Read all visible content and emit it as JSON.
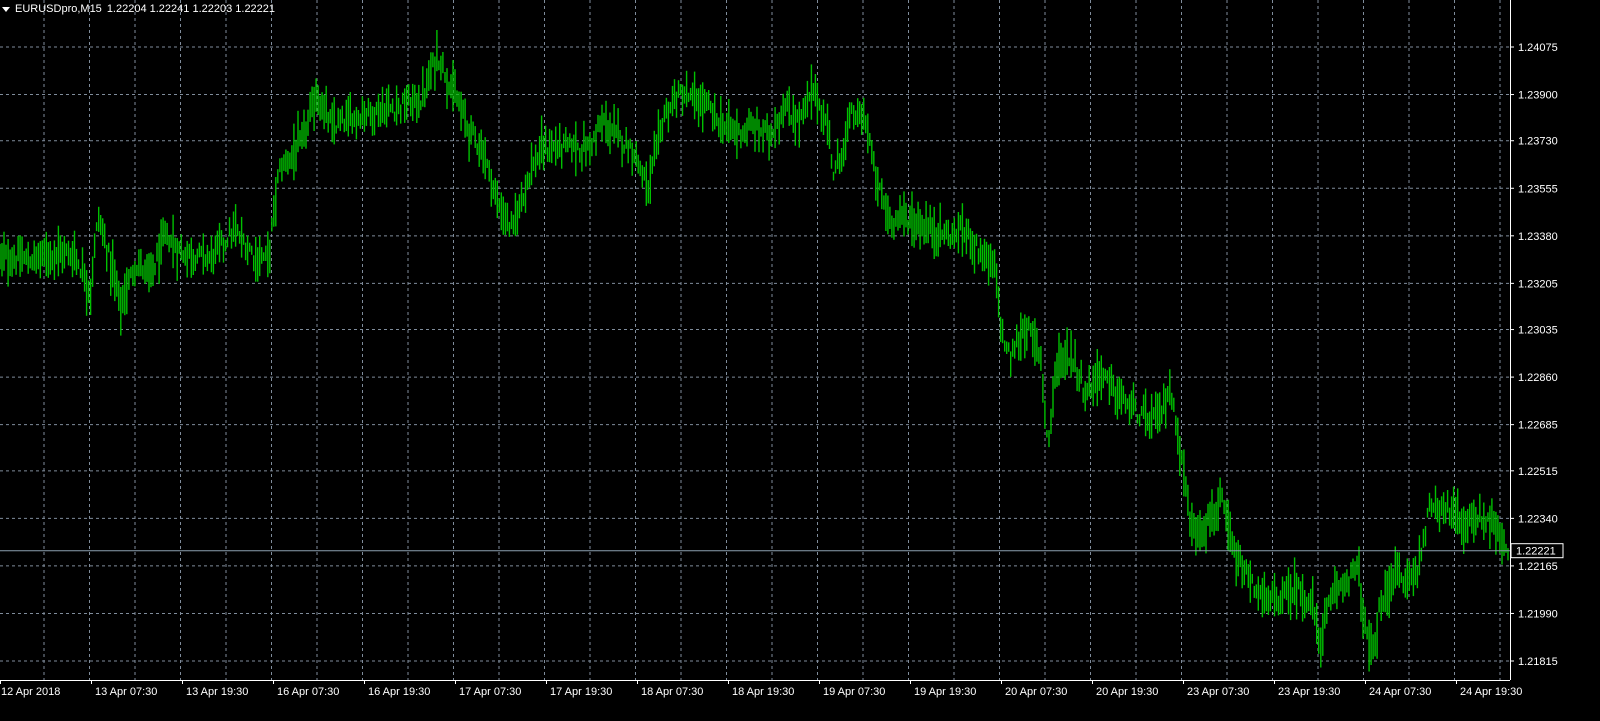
{
  "header": {
    "symbol": "EURUSDpro,M15",
    "ohlc": "1.22204 1.22241 1.22203 1.22221"
  },
  "colors": {
    "background": "#000000",
    "grid": "#7f8c9b",
    "bars": "#00c000",
    "axis": "#ffffff",
    "current_line": "#8ca0b0"
  },
  "chart_data": {
    "type": "ohlc",
    "symbol": "EURUSDpro",
    "timeframe": "M15",
    "current_price": 1.22221,
    "current_price_label": "1.22221",
    "y_ticks": [
      "1.24075",
      "1.23900",
      "1.23730",
      "1.23555",
      "1.23380",
      "1.23205",
      "1.23035",
      "1.22860",
      "1.22685",
      "1.22515",
      "1.22340",
      "1.22165",
      "1.21990",
      "1.21815"
    ],
    "ylim": [
      1.21745,
      1.24145
    ],
    "x_ticks": [
      "12 Apr 2018",
      "13 Apr 07:30",
      "13 Apr 19:30",
      "16 Apr 07:30",
      "16 Apr 19:30",
      "17 Apr 07:30",
      "17 Apr 19:30",
      "18 Apr 07:30",
      "18 Apr 19:30",
      "19 Apr 07:30",
      "19 Apr 19:30",
      "20 Apr 07:30",
      "20 Apr 19:30",
      "23 Apr 07:30",
      "23 Apr 19:30",
      "24 Apr 07:30",
      "24 Apr 19:30"
    ],
    "grid": true,
    "price_path": [
      [
        0,
        1.233
      ],
      [
        0.02,
        1.2329
      ],
      [
        0.035,
        1.2332
      ],
      [
        0.05,
        1.2331
      ],
      [
        0.06,
        1.2318
      ],
      [
        0.065,
        1.2345
      ],
      [
        0.075,
        1.2325
      ],
      [
        0.08,
        1.2312
      ],
      [
        0.09,
        1.2328
      ],
      [
        0.1,
        1.2323
      ],
      [
        0.11,
        1.2338
      ],
      [
        0.12,
        1.2332
      ],
      [
        0.13,
        1.2331
      ],
      [
        0.14,
        1.233
      ],
      [
        0.155,
        1.234
      ],
      [
        0.17,
        1.233
      ],
      [
        0.178,
        1.233
      ],
      [
        0.185,
        1.2362
      ],
      [
        0.2,
        1.2372
      ],
      [
        0.21,
        1.239
      ],
      [
        0.22,
        1.2378
      ],
      [
        0.24,
        1.2383
      ],
      [
        0.26,
        1.2385
      ],
      [
        0.28,
        1.2388
      ],
      [
        0.29,
        1.2405
      ],
      [
        0.3,
        1.2392
      ],
      [
        0.31,
        1.2378
      ],
      [
        0.32,
        1.237
      ],
      [
        0.325,
        1.236
      ],
      [
        0.33,
        1.235
      ],
      [
        0.34,
        1.234
      ],
      [
        0.35,
        1.236
      ],
      [
        0.36,
        1.237
      ],
      [
        0.38,
        1.2371
      ],
      [
        0.39,
        1.237
      ],
      [
        0.4,
        1.238
      ],
      [
        0.41,
        1.2374
      ],
      [
        0.42,
        1.237
      ],
      [
        0.43,
        1.2355
      ],
      [
        0.44,
        1.2382
      ],
      [
        0.45,
        1.239
      ],
      [
        0.46,
        1.2388
      ],
      [
        0.47,
        1.2385
      ],
      [
        0.48,
        1.2378
      ],
      [
        0.49,
        1.2376
      ],
      [
        0.5,
        1.2378
      ],
      [
        0.51,
        1.2375
      ],
      [
        0.52,
        1.2385
      ],
      [
        0.53,
        1.238
      ],
      [
        0.54,
        1.2392
      ],
      [
        0.55,
        1.2375
      ],
      [
        0.553,
        1.236
      ],
      [
        0.56,
        1.2372
      ],
      [
        0.565,
        1.2383
      ],
      [
        0.575,
        1.238
      ],
      [
        0.58,
        1.236
      ],
      [
        0.585,
        1.2352
      ],
      [
        0.59,
        1.2344
      ],
      [
        0.6,
        1.2345
      ],
      [
        0.61,
        1.2342
      ],
      [
        0.62,
        1.234
      ],
      [
        0.63,
        1.2338
      ],
      [
        0.64,
        1.234
      ],
      [
        0.66,
        1.2325
      ],
      [
        0.665,
        1.23
      ],
      [
        0.67,
        1.2293
      ],
      [
        0.68,
        1.2305
      ],
      [
        0.69,
        1.2295
      ],
      [
        0.695,
        1.226
      ],
      [
        0.7,
        1.229
      ],
      [
        0.71,
        1.2295
      ],
      [
        0.72,
        1.228
      ],
      [
        0.73,
        1.2288
      ],
      [
        0.74,
        1.228
      ],
      [
        0.75,
        1.2275
      ],
      [
        0.76,
        1.227
      ],
      [
        0.77,
        1.2272
      ],
      [
        0.775,
        1.2282
      ],
      [
        0.78,
        1.227
      ],
      [
        0.785,
        1.225
      ],
      [
        0.79,
        1.223
      ],
      [
        0.8,
        1.2232
      ],
      [
        0.81,
        1.224
      ],
      [
        0.815,
        1.2228
      ],
      [
        0.82,
        1.2218
      ],
      [
        0.83,
        1.221
      ],
      [
        0.84,
        1.2203
      ],
      [
        0.85,
        1.2205
      ],
      [
        0.86,
        1.2208
      ],
      [
        0.87,
        1.2203
      ],
      [
        0.875,
        1.2188
      ],
      [
        0.88,
        1.22
      ],
      [
        0.89,
        1.221
      ],
      [
        0.9,
        1.2216
      ],
      [
        0.905,
        1.2195
      ],
      [
        0.91,
        1.2182
      ],
      [
        0.915,
        1.22
      ],
      [
        0.92,
        1.2208
      ],
      [
        0.925,
        1.2215
      ],
      [
        0.93,
        1.221
      ],
      [
        0.94,
        1.2215
      ],
      [
        0.945,
        1.223
      ],
      [
        0.95,
        1.224
      ],
      [
        0.96,
        1.2238
      ],
      [
        0.97,
        1.2232
      ],
      [
        0.98,
        1.2234
      ],
      [
        0.99,
        1.2233
      ],
      [
        0.995,
        1.2225
      ],
      [
        1.0,
        1.2222
      ]
    ]
  }
}
